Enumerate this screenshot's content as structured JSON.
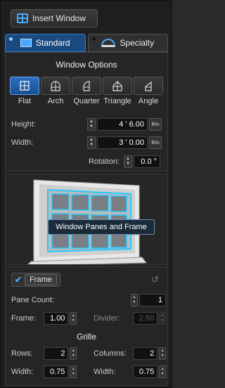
{
  "insert_button": {
    "label": "Insert Window"
  },
  "tabs": [
    {
      "label": "Standard",
      "active": true
    },
    {
      "label": "Specialty",
      "active": false
    }
  ],
  "window_options": {
    "title": "Window Options",
    "shapes": [
      {
        "label": "Flat",
        "icon": "grid-window-icon",
        "selected": true
      },
      {
        "label": "Arch",
        "icon": "arch-window-icon",
        "selected": false
      },
      {
        "label": "Quarter",
        "icon": "quarter-window-icon",
        "selected": false
      },
      {
        "label": "Triangle",
        "icon": "triangle-window-icon",
        "selected": false
      },
      {
        "label": "Angle",
        "icon": "angle-window-icon",
        "selected": false
      }
    ],
    "height": {
      "label": "Height:",
      "value": "4 ' 6.00",
      "unit": "ft/in"
    },
    "width": {
      "label": "Width:",
      "value": "3 ' 0.00",
      "unit": "ft/in"
    },
    "rotation": {
      "label": "Rotation:",
      "value": "0.0 °"
    }
  },
  "preview": {
    "tooltip": "Window Panes and Frame"
  },
  "frame": {
    "toggle_label": "Frame",
    "checked": true,
    "pane_count": {
      "label": "Pane Count:",
      "value": "1"
    },
    "frame": {
      "label": "Frame:",
      "value": "1.00"
    },
    "divider": {
      "label": "Divider:",
      "value": "2.50"
    },
    "grille_title": "Grille",
    "rows": {
      "label": "Rows:",
      "value": "2"
    },
    "columns": {
      "label": "Columns:",
      "value": "2"
    },
    "rows_width": {
      "label": "Width:",
      "value": "0.75"
    },
    "columns_width": {
      "label": "Width:",
      "value": "0.75"
    }
  },
  "colors": {
    "accent": "#4aa8ff",
    "tab_active": "#1a4a80",
    "panel_bg": "#1e1e1e"
  }
}
